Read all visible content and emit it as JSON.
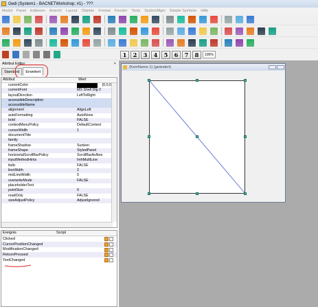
{
  "window": {
    "title": "Gedi (System1 - BACNETWorkshop; #1) - ???"
  },
  "menu": [
    "Modul",
    "Panel",
    "Editieren",
    "Ansicht",
    "Layout",
    "Objekte",
    "Format",
    "Fenster",
    "Tools",
    "SystemMgm",
    "Simple Symbols",
    "Hilfe"
  ],
  "toolbar": {
    "zoom": "100%",
    "numbers": [
      "1",
      "2",
      "3",
      "4",
      "5",
      "6",
      "7",
      "8"
    ],
    "icons": [
      "new-icon",
      "open-icon",
      "save-icon",
      "print-icon",
      "cut-icon",
      "copy-icon",
      "paste-icon",
      "undo-icon",
      "redo-icon",
      "grid-icon",
      "line-icon",
      "rect-icon",
      "ellipse-icon",
      "arc-icon",
      "text-icon",
      "image-icon",
      "table-icon",
      "button-icon",
      "combo-icon",
      "chart-icon",
      "color-icon"
    ]
  },
  "editor": {
    "title": "Attribut Editor",
    "close": "×",
    "tabs": [
      "Standard",
      "Erweitert"
    ],
    "col_attr": "Attribut",
    "col_value": "Wert"
  },
  "properties": [
    {
      "name": "currentColor",
      "value": "{0,0,0"
    },
    {
      "name": "currentFont",
      "value": "MS Shell Dlg 2"
    },
    {
      "name": "layoutDirection",
      "value": "LeftToRight"
    },
    {
      "name": "accessibleDescription",
      "value": ""
    },
    {
      "name": "accessibleName",
      "value": ""
    },
    {
      "name": "alignment",
      "value": "AlignLeft"
    },
    {
      "name": "autoFormatting",
      "value": "AutoNone"
    },
    {
      "name": "bold",
      "value": "FALSE"
    },
    {
      "name": "contextMenuPolicy",
      "value": "DefaultContext"
    },
    {
      "name": "cursorWidth",
      "value": "1"
    },
    {
      "name": "documentTitle",
      "value": ""
    },
    {
      "name": "family",
      "value": ""
    },
    {
      "name": "frameShadow",
      "value": "Sunken"
    },
    {
      "name": "frameShape",
      "value": "StyledPanel"
    },
    {
      "name": "horizontalScrollBarPolicy",
      "value": "ScrollBarAsNee"
    },
    {
      "name": "inputMethodHints",
      "value": "ImhMultiLine"
    },
    {
      "name": "italic",
      "value": "FALSE"
    },
    {
      "name": "lineWidth",
      "value": "2"
    },
    {
      "name": "midLineWidth",
      "value": "0"
    },
    {
      "name": "overwriteMode",
      "value": "FALSE"
    },
    {
      "name": "placeholderText",
      "value": ""
    },
    {
      "name": "pointSize",
      "value": "0"
    },
    {
      "name": "readOnly",
      "value": "FALSE"
    },
    {
      "name": "sizeAdjustPolicy",
      "value": "AdjustIgnored"
    }
  ],
  "events": {
    "col_event": "Ereignis",
    "col_script": "Script",
    "items": [
      "Clicked",
      "CursorPositionChanged",
      "ModificationChanged",
      "ReturnPressed",
      "TextChanged"
    ]
  },
  "subwindow": {
    "title": "(KeinName-1) (geändert)"
  }
}
